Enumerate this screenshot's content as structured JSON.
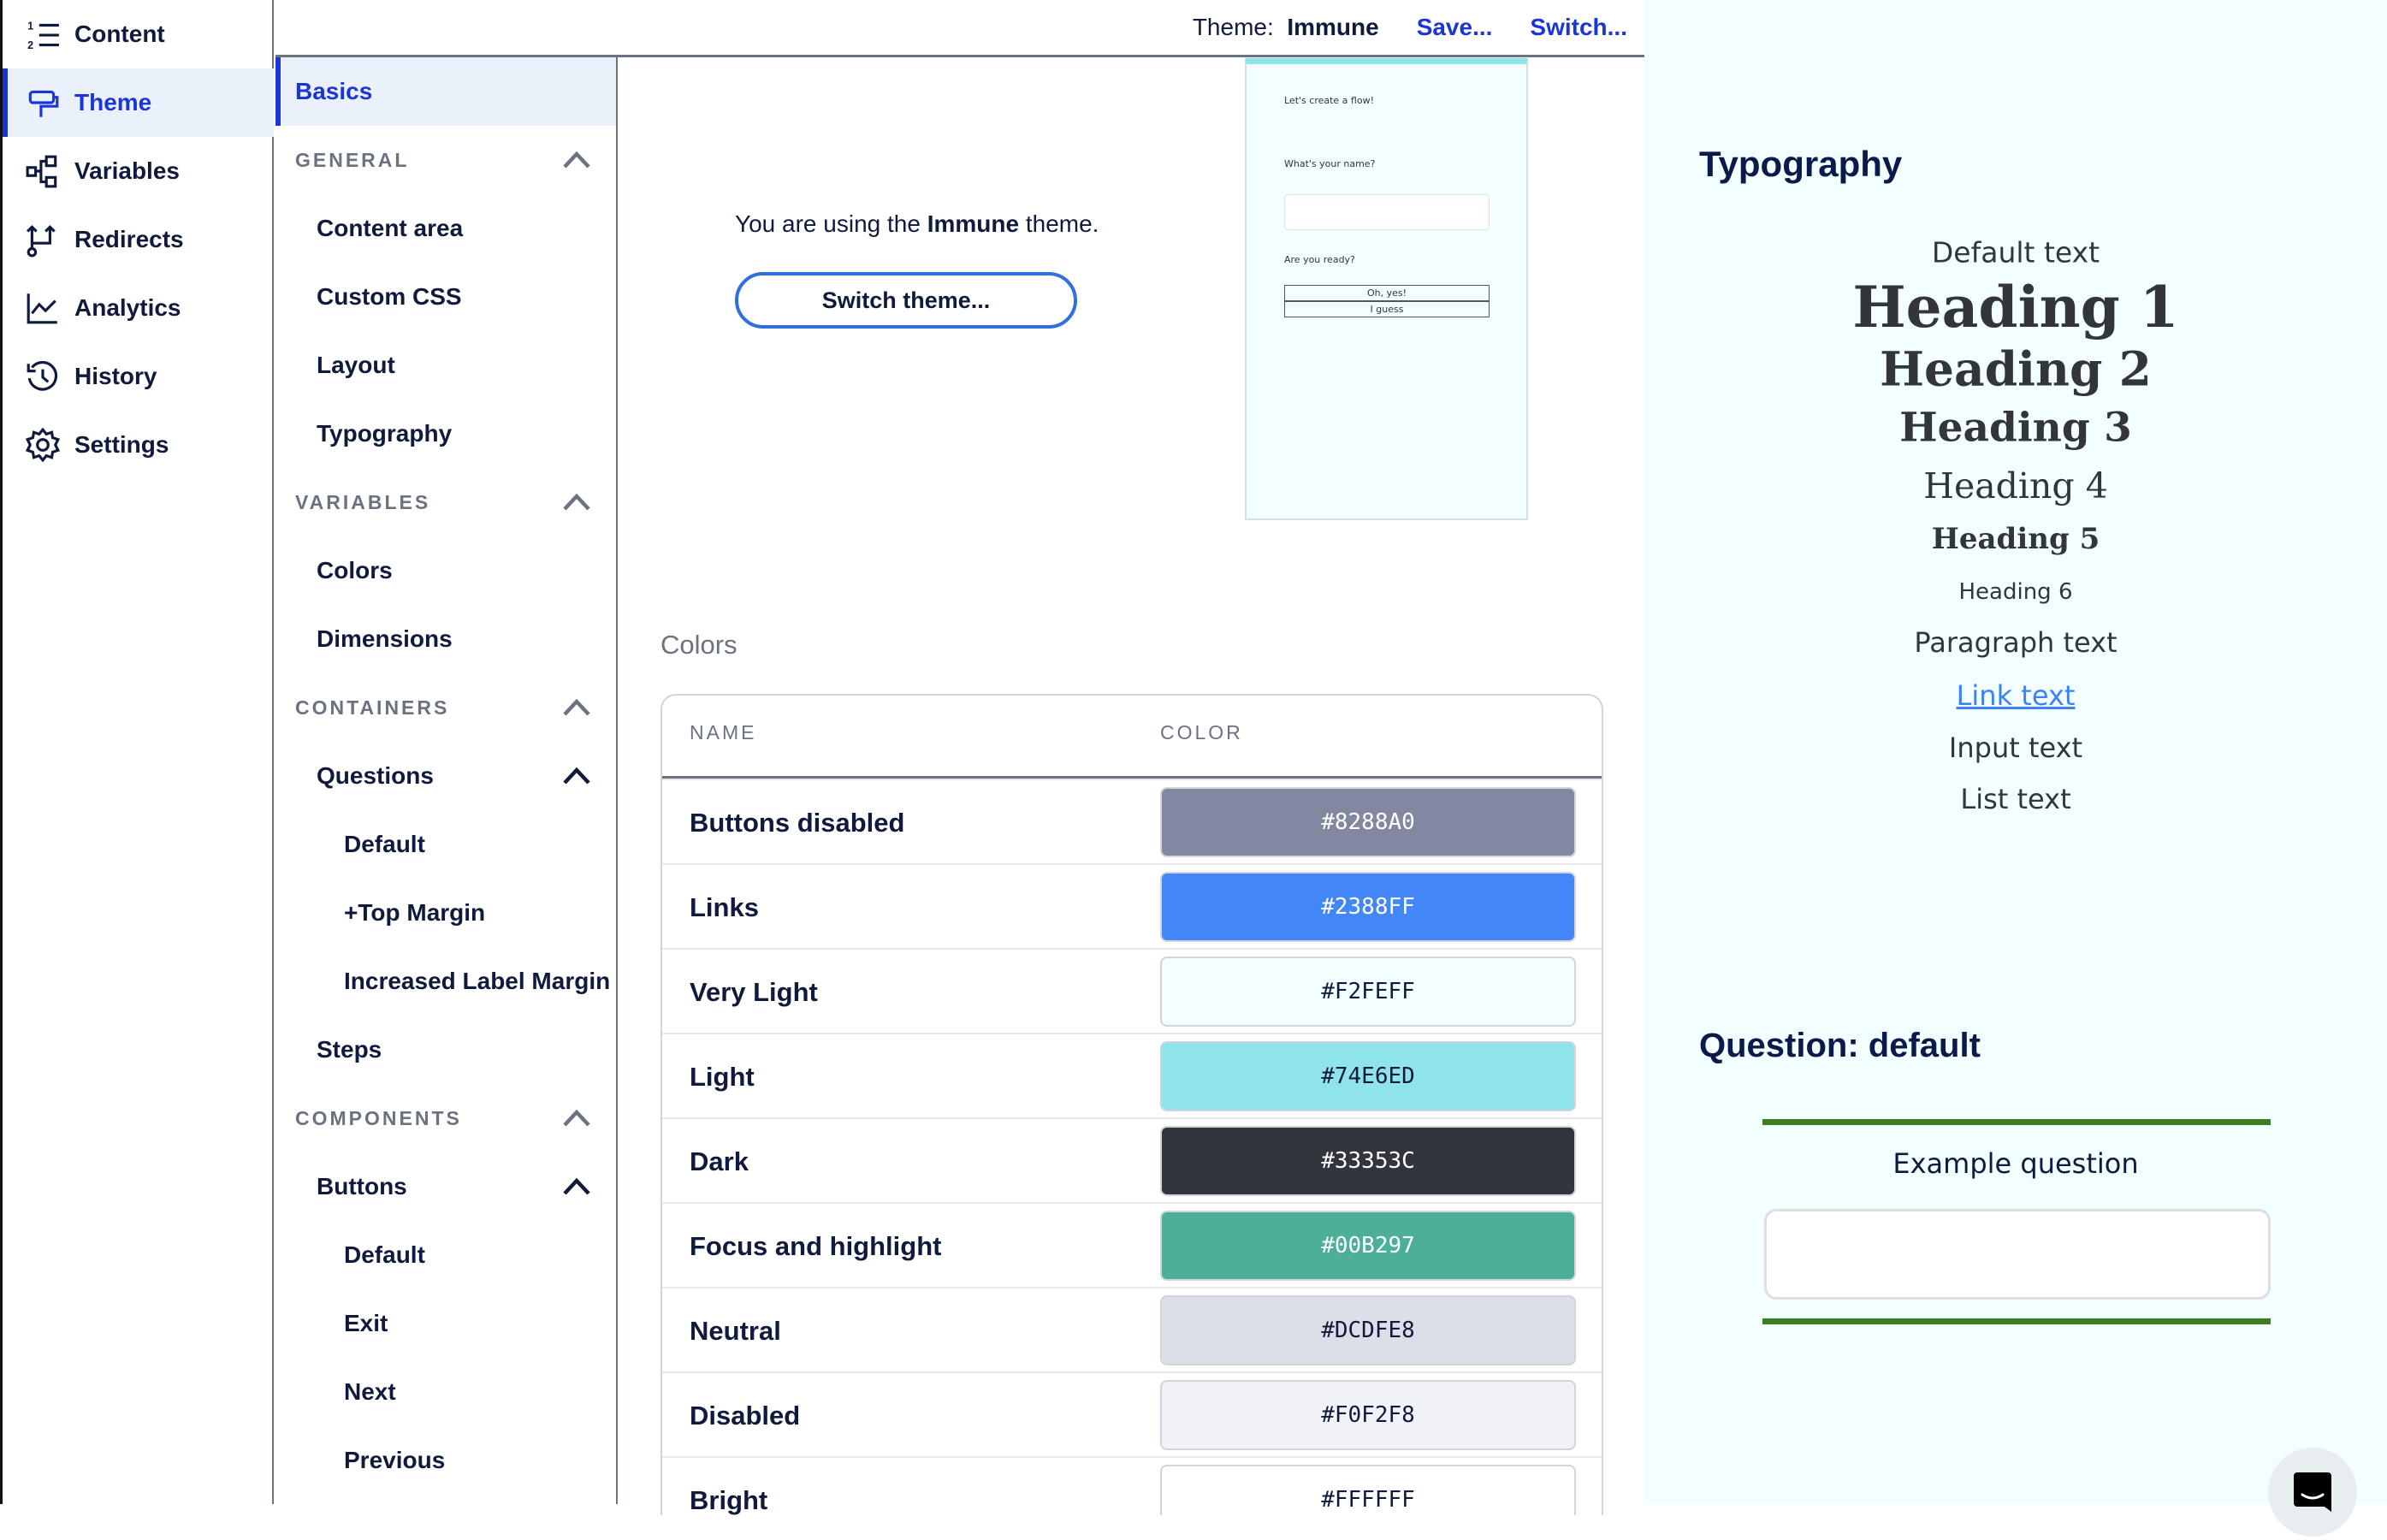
{
  "nav": {
    "items": [
      {
        "label": "Content",
        "icon": "numbered-list-icon"
      },
      {
        "label": "Theme",
        "icon": "paint-roller-icon",
        "active": true
      },
      {
        "label": "Variables",
        "icon": "variables-icon"
      },
      {
        "label": "Redirects",
        "icon": "redirect-icon"
      },
      {
        "label": "Analytics",
        "icon": "chart-line-icon"
      },
      {
        "label": "History",
        "icon": "history-icon"
      },
      {
        "label": "Settings",
        "icon": "gear-icon"
      }
    ]
  },
  "topbar": {
    "theme_label": "Theme:",
    "theme_name": "Immune",
    "save": "Save...",
    "switch": "Switch..."
  },
  "subnav": {
    "items": [
      {
        "label": "Basics",
        "type": "active"
      },
      {
        "label": "GENERAL",
        "type": "hdr",
        "chevron": "up"
      },
      {
        "label": "Content area",
        "type": "l1"
      },
      {
        "label": "Custom CSS",
        "type": "l1"
      },
      {
        "label": "Layout",
        "type": "l1"
      },
      {
        "label": "Typography",
        "type": "l1"
      },
      {
        "label": "VARIABLES",
        "type": "hdr",
        "chevron": "up"
      },
      {
        "label": "Colors",
        "type": "l1"
      },
      {
        "label": "Dimensions",
        "type": "l1"
      },
      {
        "label": "CONTAINERS",
        "type": "hdr",
        "chevron": "up"
      },
      {
        "label": "Questions",
        "type": "l1",
        "chevron": "up"
      },
      {
        "label": "Default",
        "type": "l2"
      },
      {
        "label": "+Top Margin",
        "type": "l2"
      },
      {
        "label": "Increased Label Margin",
        "type": "l2"
      },
      {
        "label": "Steps",
        "type": "l1"
      },
      {
        "label": "COMPONENTS",
        "type": "hdr",
        "chevron": "up"
      },
      {
        "label": "Buttons",
        "type": "l1",
        "chevron": "up"
      },
      {
        "label": "Default",
        "type": "l2"
      },
      {
        "label": "Exit",
        "type": "l2"
      },
      {
        "label": "Next",
        "type": "l2"
      },
      {
        "label": "Previous",
        "type": "l2"
      }
    ]
  },
  "main": {
    "using_prefix": "You are using the ",
    "using_theme": "Immune",
    "using_suffix": " theme.",
    "switch_button": "Switch theme...",
    "preview": {
      "title": "Let's create a flow!",
      "q1": "What's your name?",
      "q2": "Are you ready?",
      "opt1": "Oh, yes!",
      "opt2": "I guess"
    },
    "colors_title": "Colors",
    "table": {
      "headers": [
        "NAME",
        "COLOR"
      ],
      "rows": [
        {
          "name": "Buttons disabled",
          "hex": "#8288A0",
          "bg": "#8288A0",
          "fg": "#ffffff"
        },
        {
          "name": "Links",
          "hex": "#2388FF",
          "bg": "#4287f5",
          "fg": "#ffffff"
        },
        {
          "name": "Very Light",
          "hex": "#F2FEFF",
          "bg": "#F2FEFF",
          "fg": "#0f1a3d"
        },
        {
          "name": "Light",
          "hex": "#74E6ED",
          "bg": "#8fe4ea",
          "fg": "#0f1a3d"
        },
        {
          "name": "Dark",
          "hex": "#33353C",
          "bg": "#33353C",
          "fg": "#ffffff"
        },
        {
          "name": "Focus and highlight",
          "hex": "#00B297",
          "bg": "#4daf97",
          "fg": "#ffffff"
        },
        {
          "name": "Neutral",
          "hex": "#DCDFE8",
          "bg": "#DCDFE8",
          "fg": "#0f1a3d"
        },
        {
          "name": "Disabled",
          "hex": "#F0F2F8",
          "bg": "#F0F2F8",
          "fg": "#0f1a3d"
        },
        {
          "name": "Bright",
          "hex": "#FFFFFF",
          "bg": "#FFFFFF",
          "fg": "#0f1a3d"
        }
      ]
    }
  },
  "right": {
    "typography_title": "Typography",
    "samples": {
      "default": "Default text",
      "h1": "Heading 1",
      "h2": "Heading 2",
      "h3": "Heading 3",
      "h4": "Heading 4",
      "h5": "Heading 5",
      "h6": "Heading 6",
      "para": "Paragraph text",
      "link": "Link text",
      "input": "Input text",
      "list": "List text"
    },
    "question_title": "Question: default",
    "example_question": "Example question"
  },
  "colors": {
    "accent": "#1a36d8",
    "link": "#2388FF",
    "panel_bg": "#F2FEFF",
    "question_border": "#3a7d22"
  }
}
